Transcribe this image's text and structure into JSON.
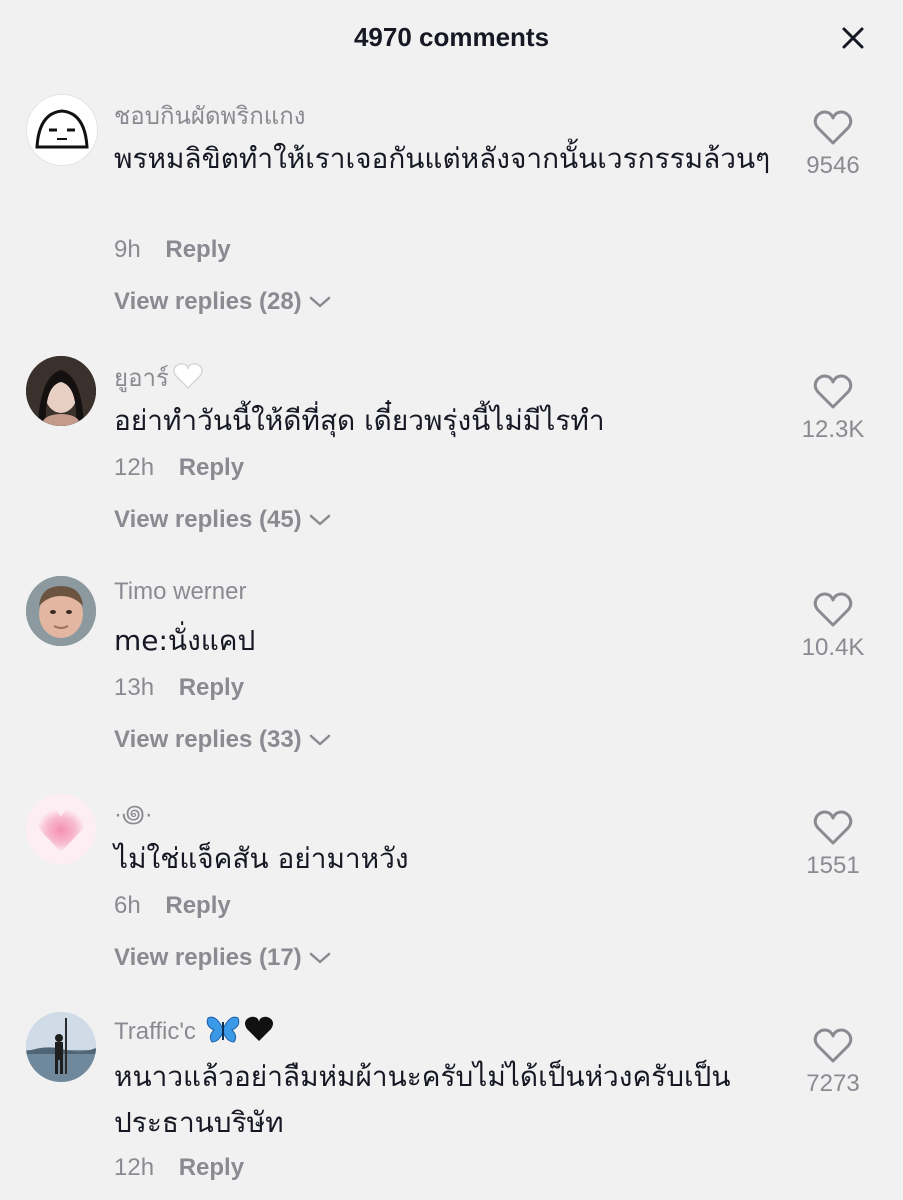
{
  "header": {
    "title": "4970 comments",
    "close_icon": "close-icon"
  },
  "comments": [
    {
      "username": "ชอบกินผัดพริกแกง",
      "text": "พรหมลิขิตทำให้เราเจอกันแต่หลังจากนั้นเวรกรรมล้วนๆ",
      "time": "9h",
      "reply_label": "Reply",
      "view_replies": "View replies (28)",
      "likes": "9546"
    },
    {
      "username": "ยูอาร์",
      "username_emoji": "white-heart",
      "text": "อย่าทำวันนี้ให้ดีที่สุด เดี๋ยวพรุ่งนี้ไม่มีไรทำ",
      "time": "12h",
      "reply_label": "Reply",
      "view_replies": "View replies (45)",
      "likes": "12.3K"
    },
    {
      "username": "Timo werner",
      "text": "me:นั่งแคป",
      "time": "13h",
      "reply_label": "Reply",
      "view_replies": "View replies (33)",
      "likes": "10.4K"
    },
    {
      "username": "·꩜·",
      "text": "ไม่ใช่แจ็คสัน อย่ามาหวัง",
      "time": "6h",
      "reply_label": "Reply",
      "view_replies": "View replies (17)",
      "likes": "1551"
    },
    {
      "username": "Traffic'c",
      "username_emoji": "blue-butterfly black-heart",
      "text": "หนาวแล้วอย่าลืมห่มผ้านะครับไม่ได้เป็นห่วงครับเป็นประธานบริษัท",
      "time": "12h",
      "reply_label": "Reply",
      "likes": "7273"
    }
  ]
}
